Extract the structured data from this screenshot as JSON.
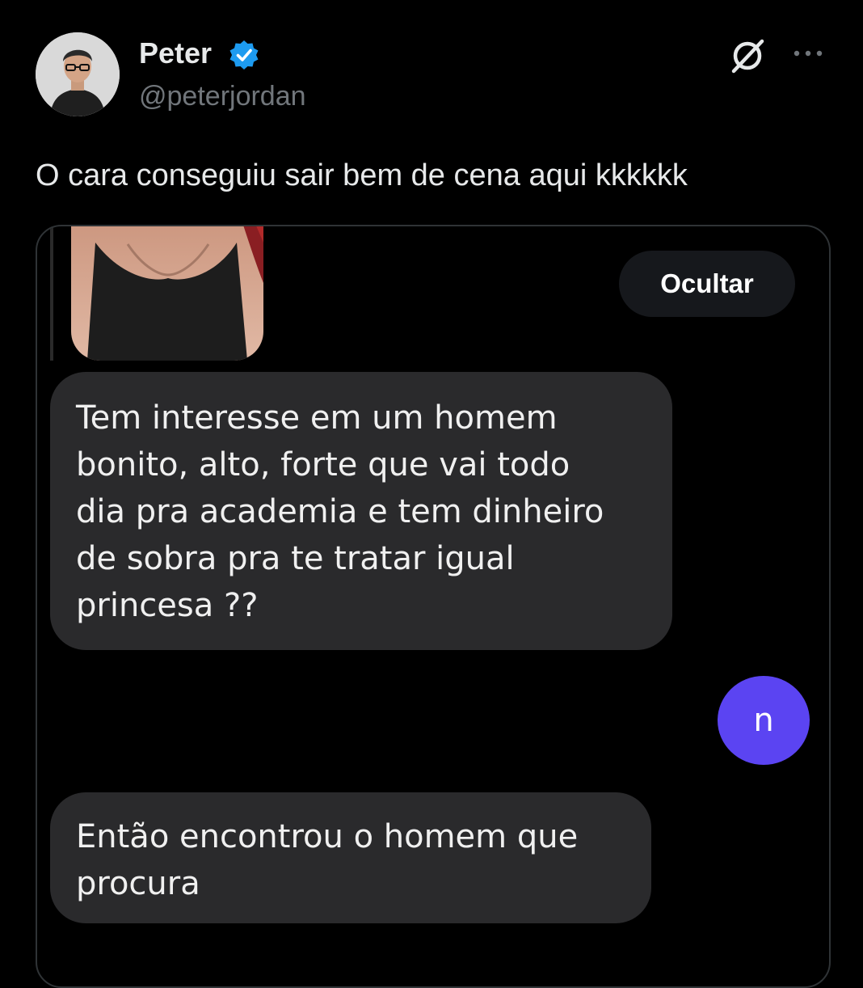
{
  "post": {
    "author": {
      "display_name": "Peter",
      "handle": "@peterjordan",
      "verified": true,
      "avatar_icon": "person-avatar"
    },
    "header_icons": [
      "grok-icon",
      "more-options-icon"
    ],
    "text": "O cara conseguiu sair bem de cena aqui kkkkkk"
  },
  "media": {
    "hide_button_label": "Ocultar",
    "messages": [
      {
        "sender": "other",
        "text": "Tem interesse em um homem\nbonito, alto, forte que vai todo\ndia pra academia e tem dinheiro\nde sobra pra te tratar igual\nprincesa ??"
      },
      {
        "sender": "me",
        "text": "n"
      },
      {
        "sender": "other",
        "text": "Então encontrou o homem que\nprocura"
      }
    ]
  },
  "colors": {
    "background": "#000000",
    "verified_badge": "#1d9bf0",
    "incoming_bubble": "#2a2a2c",
    "outgoing_bubble": "#5b44f2",
    "handle_text": "#71767b"
  }
}
